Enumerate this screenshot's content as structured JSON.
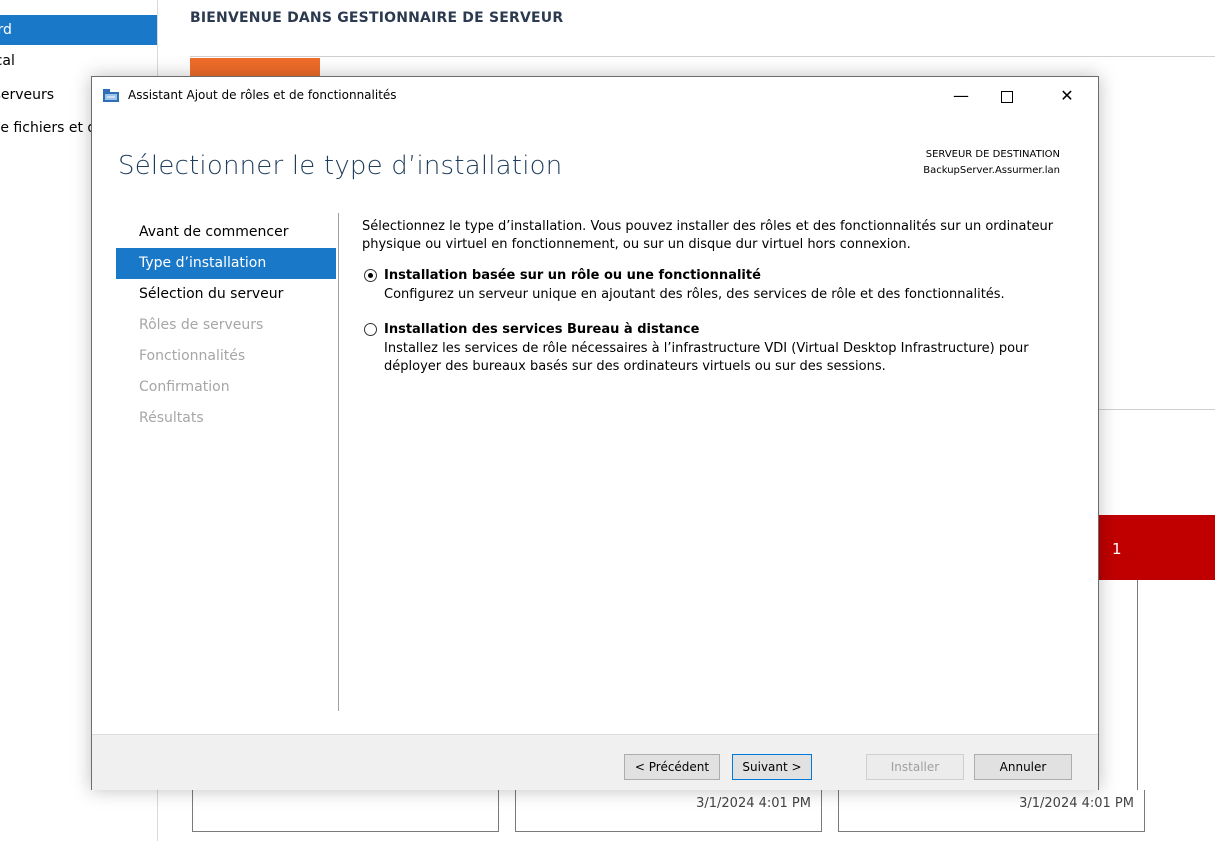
{
  "background": {
    "sidebar_items": [
      {
        "label": "Tableau de bord",
        "active": true
      },
      {
        "label": "Serveur local",
        "active": false
      },
      {
        "label": "Tous les serveurs",
        "active": false
      },
      {
        "label": "Services de fichiers et de stockage",
        "active": false
      }
    ],
    "welcome_title": "BIENVENUE DANS GESTIONNAIRE DE SERVEUR",
    "tile_count": "1",
    "card_times": [
      "3/1/2024 4:01 PM",
      "3/1/2024 4:01 PM"
    ],
    "colors": {
      "accent": "#1a78c9",
      "orange": "#ef6c29",
      "alert": "#c00000"
    }
  },
  "dialog": {
    "title": "Assistant Ajout de rôles et de fonctionnalités",
    "page_title": "Sélectionner le type d’installation",
    "destination_label": "SERVEUR DE DESTINATION",
    "destination_value": "BackupServer.Assurmer.lan",
    "steps": [
      {
        "label": "Avant de commencer",
        "state": "normal"
      },
      {
        "label": "Type d’installation",
        "state": "active"
      },
      {
        "label": "Sélection du serveur",
        "state": "normal"
      },
      {
        "label": "Rôles de serveurs",
        "state": "disabled"
      },
      {
        "label": "Fonctionnalités",
        "state": "disabled"
      },
      {
        "label": "Confirmation",
        "state": "disabled"
      },
      {
        "label": "Résultats",
        "state": "disabled"
      }
    ],
    "intro": "Sélectionnez le type d’installation. Vous pouvez installer des rôles et des fonctionnalités sur un ordinateur physique ou virtuel en fonctionnement, ou sur un disque dur virtuel hors connexion.",
    "options": [
      {
        "label": "Installation basée sur un rôle ou une fonctionnalité",
        "description": "Configurez un serveur unique en ajoutant des rôles, des services de rôle et des fonctionnalités.",
        "selected": true
      },
      {
        "label": "Installation des services Bureau à distance",
        "description": "Installez les services de rôle nécessaires à l’infrastructure VDI (Virtual Desktop Infrastructure) pour déployer des bureaux basés sur des ordinateurs virtuels ou sur des sessions.",
        "selected": false
      }
    ],
    "buttons": {
      "previous": "< Précédent",
      "next": "Suivant >",
      "install": "Installer",
      "cancel": "Annuler"
    },
    "window_controls": {
      "minimize": "minimize-icon",
      "maximize": "maximize-icon",
      "close": "close-icon"
    }
  }
}
